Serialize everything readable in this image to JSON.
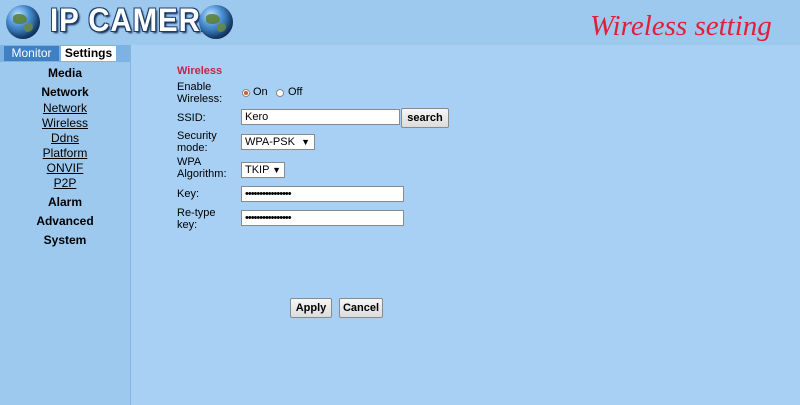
{
  "header": {
    "app_title": "IP CAMERA",
    "page_heading": "Wireless setting"
  },
  "tabs": [
    {
      "label": "Monitor"
    },
    {
      "label": "Settings"
    }
  ],
  "sidebar": {
    "media": "Media",
    "network": "Network",
    "network_items": [
      "Network",
      "Wireless",
      "Ddns",
      "Platform",
      "ONVIF",
      "P2P"
    ],
    "alarm": "Alarm",
    "advanced": "Advanced",
    "system": "System"
  },
  "form": {
    "section_title": "Wireless",
    "enable_label_1": "Enable",
    "enable_label_2": "Wireless:",
    "on_label": "On",
    "off_label": "Off",
    "ssid_label": "SSID:",
    "ssid_value": "Kero",
    "search_label": "search",
    "security_label_1": "Security",
    "security_label_2": "mode:",
    "security_value": "WPA-PSK",
    "wpa_label_1": "WPA",
    "wpa_label_2": "Algorithm:",
    "wpa_value": "TKIP",
    "key_label": "Key:",
    "key_value": "••••••••••••••••",
    "retype_label_1": "Re-type",
    "retype_label_2": "key:",
    "retype_value": "••••••••••••••••",
    "dropdown_arrow": "▼",
    "apply_label": "Apply",
    "cancel_label": "Cancel"
  },
  "colors": {
    "background": "#9ec9ef",
    "heading_red": "#e0203a",
    "section_red": "#cc2244",
    "tab_blue": "#3f7fc2"
  }
}
